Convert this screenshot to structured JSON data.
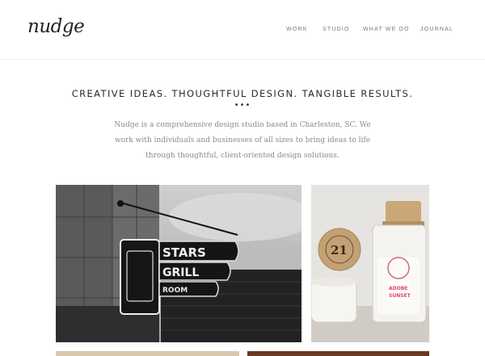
{
  "brand": {
    "logo": "nudge"
  },
  "nav": {
    "items": [
      {
        "label": "WORK"
      },
      {
        "label": "STUDIO"
      },
      {
        "label": "WHAT WE DO"
      },
      {
        "label": "JOURNAL"
      }
    ]
  },
  "hero": {
    "tagline": "CREATIVE IDEAS. THOUGHTFUL DESIGN. TANGIBLE RESULTS.",
    "ellipsis": "•••",
    "intro": "Nudge is a comprehensive design studio based in Charleston, SC. We work with individuals and businesses of all sizes to bring ideas to life through thoughtful, client-oriented design solutions."
  },
  "portfolio": {
    "stars_sign": {
      "line1": "STARS",
      "line2": "GRILL",
      "line3": "ROOM"
    },
    "candle": {
      "cork_number": "21",
      "label_line1": "ADOBE",
      "label_line2": "SUNSET"
    }
  },
  "colors": {
    "background": "#ffffff",
    "text": "#2a2a2a",
    "muted": "#8a8a8a",
    "accent_pink": "#d9436a"
  }
}
